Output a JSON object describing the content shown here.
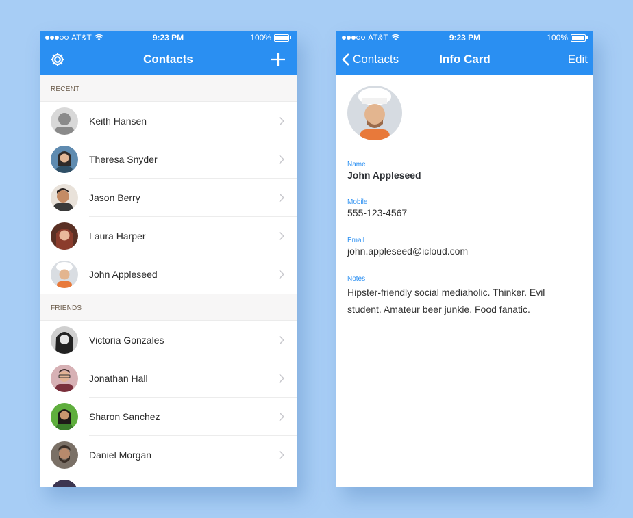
{
  "status_bar": {
    "carrier": "AT&T",
    "time": "9:23 PM",
    "battery": "100%"
  },
  "contacts_screen": {
    "title": "Contacts",
    "settings_icon": "gear-icon",
    "add_icon": "plus-icon",
    "sections": [
      {
        "header": "RECENT",
        "items": [
          {
            "name": "Keith Hansen",
            "avatar_color": "#8a8a8a"
          },
          {
            "name": "Theresa Snyder",
            "avatar_color": "#2f4f66"
          },
          {
            "name": "Jason Berry",
            "avatar_color": "#b37d5a"
          },
          {
            "name": "Laura Harper",
            "avatar_color": "#8b3c2c"
          },
          {
            "name": "John Appleseed",
            "avatar_color": "#e7a36a"
          }
        ]
      },
      {
        "header": "FRIENDS",
        "items": [
          {
            "name": "Victoria Gonzales",
            "avatar_color": "#333333"
          },
          {
            "name": "Jonathan Hall",
            "avatar_color": "#b8777e"
          },
          {
            "name": "Sharon Sanchez",
            "avatar_color": "#5fae3d"
          },
          {
            "name": "Daniel Morgan",
            "avatar_color": "#4b4034"
          }
        ]
      }
    ]
  },
  "info_screen": {
    "back_label": "Contacts",
    "title": "Info Card",
    "edit_label": "Edit",
    "fields": {
      "name": {
        "label": "Name",
        "value": "John Appleseed"
      },
      "mobile": {
        "label": "Mobile",
        "value": "555-123-4567"
      },
      "email": {
        "label": "Email",
        "value": "john.appleseed@icloud.com"
      },
      "notes": {
        "label": "Notes",
        "value": "Hipster-friendly social mediaholic. Thinker. Evil student. Amateur beer junkie. Food fanatic."
      }
    }
  },
  "colors": {
    "accent": "#2a8ff2",
    "background": "#a7cdf5",
    "section_bg": "#f7f6f6"
  }
}
